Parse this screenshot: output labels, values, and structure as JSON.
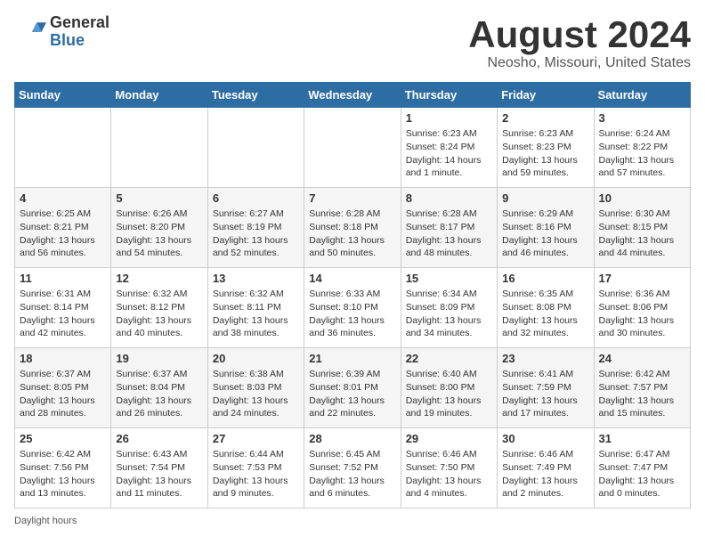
{
  "header": {
    "logo_general": "General",
    "logo_blue": "Blue",
    "title": "August 2024",
    "subtitle": "Neosho, Missouri, United States"
  },
  "days_of_week": [
    "Sunday",
    "Monday",
    "Tuesday",
    "Wednesday",
    "Thursday",
    "Friday",
    "Saturday"
  ],
  "weeks": [
    [
      {
        "day": "",
        "info": ""
      },
      {
        "day": "",
        "info": ""
      },
      {
        "day": "",
        "info": ""
      },
      {
        "day": "",
        "info": ""
      },
      {
        "day": "1",
        "info": "Sunrise: 6:23 AM\nSunset: 8:24 PM\nDaylight: 14 hours and 1 minute."
      },
      {
        "day": "2",
        "info": "Sunrise: 6:23 AM\nSunset: 8:23 PM\nDaylight: 13 hours and 59 minutes."
      },
      {
        "day": "3",
        "info": "Sunrise: 6:24 AM\nSunset: 8:22 PM\nDaylight: 13 hours and 57 minutes."
      }
    ],
    [
      {
        "day": "4",
        "info": "Sunrise: 6:25 AM\nSunset: 8:21 PM\nDaylight: 13 hours and 56 minutes."
      },
      {
        "day": "5",
        "info": "Sunrise: 6:26 AM\nSunset: 8:20 PM\nDaylight: 13 hours and 54 minutes."
      },
      {
        "day": "6",
        "info": "Sunrise: 6:27 AM\nSunset: 8:19 PM\nDaylight: 13 hours and 52 minutes."
      },
      {
        "day": "7",
        "info": "Sunrise: 6:28 AM\nSunset: 8:18 PM\nDaylight: 13 hours and 50 minutes."
      },
      {
        "day": "8",
        "info": "Sunrise: 6:28 AM\nSunset: 8:17 PM\nDaylight: 13 hours and 48 minutes."
      },
      {
        "day": "9",
        "info": "Sunrise: 6:29 AM\nSunset: 8:16 PM\nDaylight: 13 hours and 46 minutes."
      },
      {
        "day": "10",
        "info": "Sunrise: 6:30 AM\nSunset: 8:15 PM\nDaylight: 13 hours and 44 minutes."
      }
    ],
    [
      {
        "day": "11",
        "info": "Sunrise: 6:31 AM\nSunset: 8:14 PM\nDaylight: 13 hours and 42 minutes."
      },
      {
        "day": "12",
        "info": "Sunrise: 6:32 AM\nSunset: 8:12 PM\nDaylight: 13 hours and 40 minutes."
      },
      {
        "day": "13",
        "info": "Sunrise: 6:32 AM\nSunset: 8:11 PM\nDaylight: 13 hours and 38 minutes."
      },
      {
        "day": "14",
        "info": "Sunrise: 6:33 AM\nSunset: 8:10 PM\nDaylight: 13 hours and 36 minutes."
      },
      {
        "day": "15",
        "info": "Sunrise: 6:34 AM\nSunset: 8:09 PM\nDaylight: 13 hours and 34 minutes."
      },
      {
        "day": "16",
        "info": "Sunrise: 6:35 AM\nSunset: 8:08 PM\nDaylight: 13 hours and 32 minutes."
      },
      {
        "day": "17",
        "info": "Sunrise: 6:36 AM\nSunset: 8:06 PM\nDaylight: 13 hours and 30 minutes."
      }
    ],
    [
      {
        "day": "18",
        "info": "Sunrise: 6:37 AM\nSunset: 8:05 PM\nDaylight: 13 hours and 28 minutes."
      },
      {
        "day": "19",
        "info": "Sunrise: 6:37 AM\nSunset: 8:04 PM\nDaylight: 13 hours and 26 minutes."
      },
      {
        "day": "20",
        "info": "Sunrise: 6:38 AM\nSunset: 8:03 PM\nDaylight: 13 hours and 24 minutes."
      },
      {
        "day": "21",
        "info": "Sunrise: 6:39 AM\nSunset: 8:01 PM\nDaylight: 13 hours and 22 minutes."
      },
      {
        "day": "22",
        "info": "Sunrise: 6:40 AM\nSunset: 8:00 PM\nDaylight: 13 hours and 19 minutes."
      },
      {
        "day": "23",
        "info": "Sunrise: 6:41 AM\nSunset: 7:59 PM\nDaylight: 13 hours and 17 minutes."
      },
      {
        "day": "24",
        "info": "Sunrise: 6:42 AM\nSunset: 7:57 PM\nDaylight: 13 hours and 15 minutes."
      }
    ],
    [
      {
        "day": "25",
        "info": "Sunrise: 6:42 AM\nSunset: 7:56 PM\nDaylight: 13 hours and 13 minutes."
      },
      {
        "day": "26",
        "info": "Sunrise: 6:43 AM\nSunset: 7:54 PM\nDaylight: 13 hours and 11 minutes."
      },
      {
        "day": "27",
        "info": "Sunrise: 6:44 AM\nSunset: 7:53 PM\nDaylight: 13 hours and 9 minutes."
      },
      {
        "day": "28",
        "info": "Sunrise: 6:45 AM\nSunset: 7:52 PM\nDaylight: 13 hours and 6 minutes."
      },
      {
        "day": "29",
        "info": "Sunrise: 6:46 AM\nSunset: 7:50 PM\nDaylight: 13 hours and 4 minutes."
      },
      {
        "day": "30",
        "info": "Sunrise: 6:46 AM\nSunset: 7:49 PM\nDaylight: 13 hours and 2 minutes."
      },
      {
        "day": "31",
        "info": "Sunrise: 6:47 AM\nSunset: 7:47 PM\nDaylight: 13 hours and 0 minutes."
      }
    ]
  ],
  "footer": "Daylight hours"
}
